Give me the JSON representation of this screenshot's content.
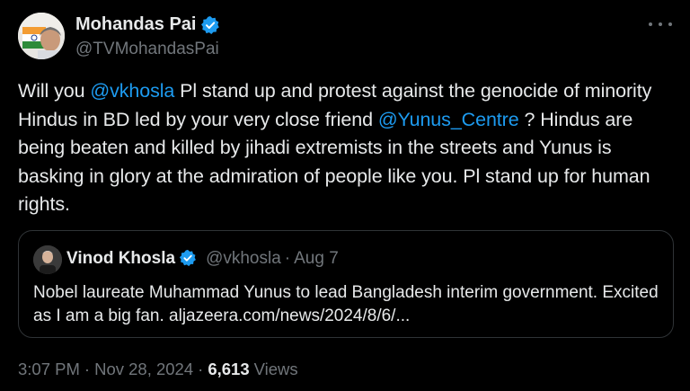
{
  "author": {
    "display_name": "Mohandas Pai",
    "handle": "@TVMohandasPai",
    "verified": true
  },
  "tweet": {
    "text_parts": [
      "Will you ",
      "@vkhosla",
      " Pl stand up and protest against the genocide of minority Hindus in BD led by your very close friend ",
      "@Yunus_Centre",
      " ? Hindus are being beaten and killed by jihadi extremists in the streets and Yunus is basking in glory at the admiration of people like you. Pl stand up for human rights."
    ]
  },
  "quote": {
    "display_name": "Vinod Khosla",
    "handle": "@vkhosla",
    "separator": "·",
    "date": "Aug 7",
    "text": "Nobel laureate Muhammad Yunus to lead Bangladesh interim government. Excited as I am a big fan.  ",
    "link": "aljazeera.com/news/2024/8/6/..."
  },
  "meta": {
    "time": "3:07 PM",
    "separator1": "·",
    "date": "Nov 28, 2024",
    "separator2": "·",
    "views_count": "6,613",
    "views_label": "Views"
  },
  "icons": {
    "verified": "verified-badge-icon",
    "more": "more-options-icon"
  },
  "colors": {
    "background": "#000000",
    "text": "#e7e9ea",
    "secondary": "#71767b",
    "accent": "#1d9bf0",
    "border": "#2f3336"
  }
}
